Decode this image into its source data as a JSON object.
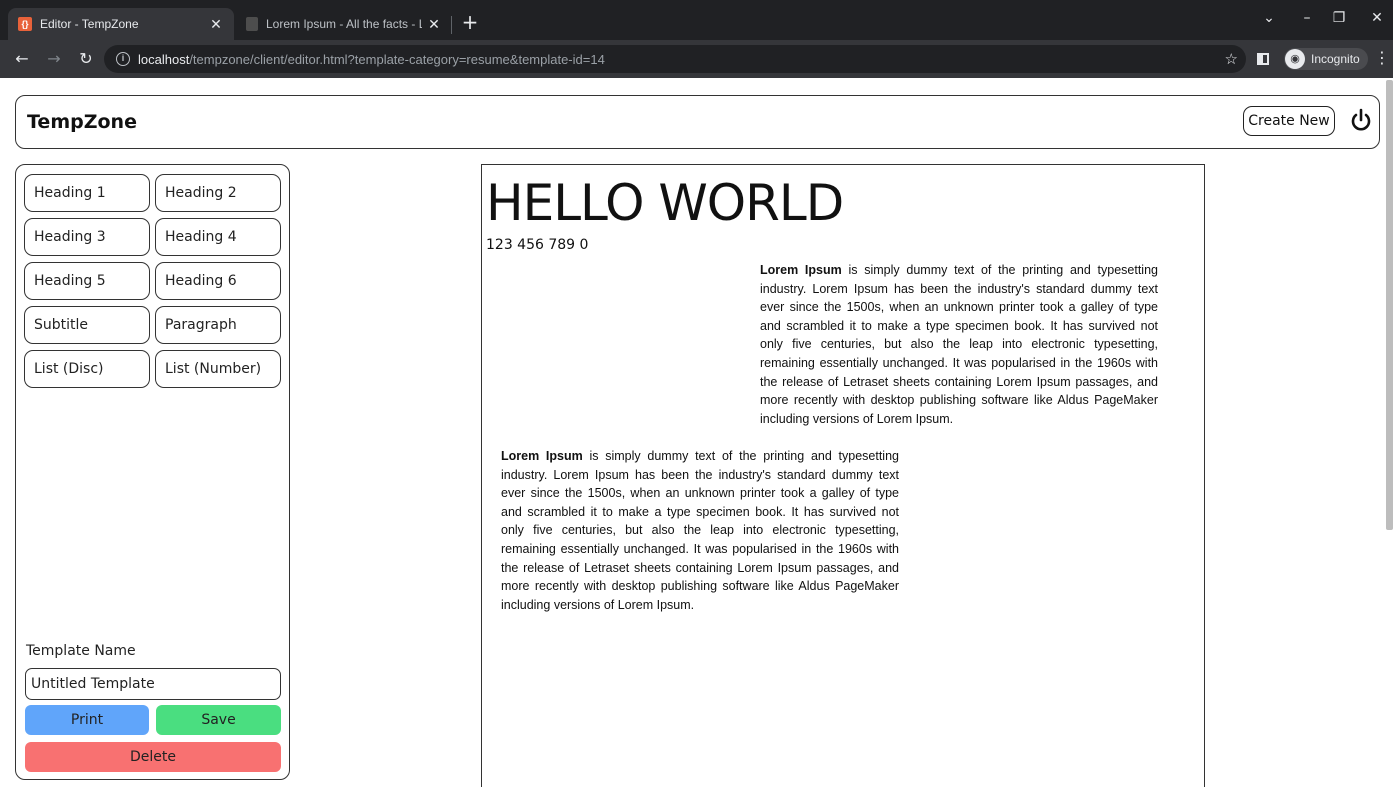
{
  "browser": {
    "tabs": [
      {
        "title": "Editor - TempZone",
        "favicon": "tempzone-favicon",
        "active": true
      },
      {
        "title": "Lorem Ipsum - All the facts - Lips",
        "favicon": "lipsum-favicon",
        "active": false
      }
    ],
    "url": {
      "host": "localhost",
      "path": "/tempzone/client/editor.html?template-category=resume&template-id=14"
    },
    "profile_label": "Incognito"
  },
  "header": {
    "brand": "TempZone",
    "create_new_label": "Create New"
  },
  "sidebar": {
    "components": [
      "Heading 1",
      "Heading 2",
      "Heading 3",
      "Heading 4",
      "Heading 5",
      "Heading 6",
      "Subtitle",
      "Paragraph",
      "List (Disc)",
      "List (Number)"
    ],
    "template_name_label": "Template Name",
    "template_name_value": "Untitled Template",
    "print_label": "Print",
    "save_label": "Save",
    "delete_label": "Delete"
  },
  "canvas": {
    "title": "HELLO WORLD",
    "phone": "123 456 789 0",
    "paragraph_lead": "Lorem Ipsum",
    "paragraph_body": " is simply dummy text of the printing and typesetting industry. Lorem Ipsum has been the industry's standard dummy text ever since the 1500s, when an unknown printer took a galley of type and scrambled it to make a type specimen book. It has survived not only five centuries, but also the leap into electronic typesetting, remaining essentially unchanged. It was popularised in the 1960s with the release of Letraset sheets containing Lorem Ipsum passages, and more recently with desktop publishing software like Aldus PageMaker including versions of Lorem Ipsum."
  },
  "colors": {
    "print": "#60a5fa",
    "save": "#4ade80",
    "delete": "#f87171",
    "chrome_dark": "#202124",
    "chrome_toolbar": "#35363a"
  }
}
